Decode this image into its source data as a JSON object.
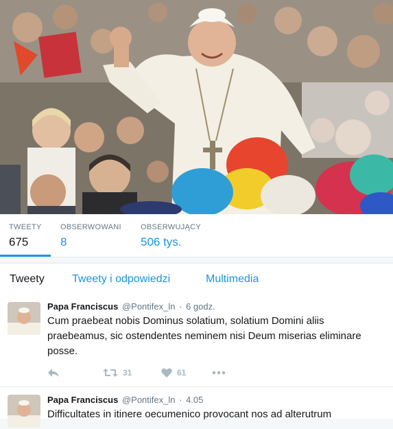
{
  "profile_stats": [
    {
      "label": "TWEETY",
      "value": "675"
    },
    {
      "label": "OBSERWOWANI",
      "value": "8"
    },
    {
      "label": "OBSERWUJĄCY",
      "value": "506 tys."
    }
  ],
  "tabs": [
    {
      "label": "Tweety"
    },
    {
      "label": "Tweety i odpowiedzi"
    },
    {
      "label": "Multimedia"
    }
  ],
  "tweets": [
    {
      "name": "Papa Franciscus",
      "handle": "@Pontifex_ln",
      "separator": "·",
      "time": "6 godz.",
      "text": "Cum praebeat nobis Dominus solatium, solatium Domini aliis praebeamus, sic ostendentes neminem nisi Deum miserias eliminare posse.",
      "retweets": "31",
      "likes": "61"
    },
    {
      "name": "Papa Franciscus",
      "handle": "@Pontifex_ln",
      "separator": "·",
      "time": "4.05",
      "text": "Difficultates in itinere oecumenico provocant nos ad alterutrum"
    }
  ],
  "colors": {
    "link": "#1b95e0",
    "muted": "#657786",
    "action_icon": "#aab8c2",
    "background": "#f5f8fa"
  },
  "icons": [
    "reply-icon",
    "retweet-icon",
    "like-icon",
    "more-icon"
  ]
}
